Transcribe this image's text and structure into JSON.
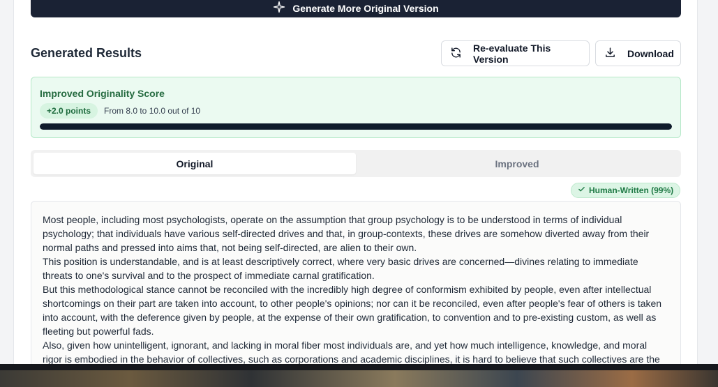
{
  "header": {
    "generate_label": "Generate More Original Version"
  },
  "results": {
    "title": "Generated Results",
    "reevaluate_label": "Re-evaluate This Version",
    "download_label": "Download"
  },
  "score": {
    "title": "Improved Originality Score",
    "points": "+2.0 points",
    "range": "From 8.0 to 10.0 out of 10",
    "progress_fraction": 1.0
  },
  "tabs": [
    {
      "label": "Original",
      "active": true
    },
    {
      "label": "Improved",
      "active": false
    }
  ],
  "badge": {
    "label": "Human-Written (99%)"
  },
  "text": {
    "paragraphs": [
      "Most people, including most psychologists, operate on the assumption that group psychology is to be understood in terms of individual psychology; that individuals have various self-directed drives and that, in group-contexts, these drives are somehow diverted away from their normal paths and pressed into aims that, not being self-directed, are alien to their own.",
      "This position is understandable, and is at least descriptively correct, where very basic drives are concerned—divines relating to immediate threats to one's survival and to the prospect of immediate carnal gratification.",
      "But this methodological stance cannot be reconciled with the incredibly high degree of conformism exhibited by people, even after intellectual shortcomings on their part are taken into account, to other people's opinions; nor can it be reconciled, even after people's fear of others is taken into account, with the deference given by people, at the expense of their own gratification, to convention and to pre-existing custom, as well as fleeting but powerful fads.",
      "Also, given how unintelligent, ignorant, and lacking in moral fiber most individuals are, and yet how much intelligence, knowledge, and moral rigor is embodied in the behavior of collectives, such as corporations and academic disciplines, it is hard to believe that such collectives are the"
    ]
  },
  "colors": {
    "primary_dark": "#1a2234",
    "success_bg": "#ebfaf1",
    "success_text": "#256b40"
  },
  "icons": [
    "sparkle-icon",
    "refresh-icon",
    "download-icon",
    "check-icon"
  ]
}
